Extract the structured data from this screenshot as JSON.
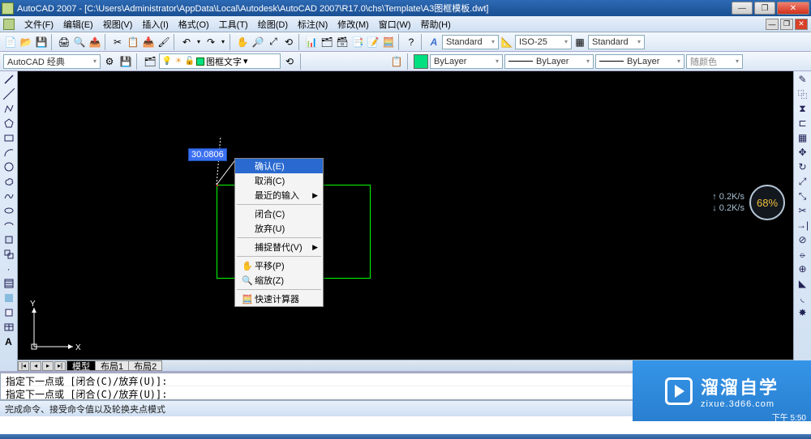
{
  "title": "AutoCAD 2007 - [C:\\Users\\Administrator\\AppData\\Local\\Autodesk\\AutoCAD 2007\\R17.0\\chs\\Template\\A3图框模板.dwt]",
  "menus": [
    "文件(F)",
    "编辑(E)",
    "视图(V)",
    "插入(I)",
    "格式(O)",
    "工具(T)",
    "绘图(D)",
    "标注(N)",
    "修改(M)",
    "窗口(W)",
    "帮助(H)"
  ],
  "workspace_combo": "AutoCAD 经典",
  "layer_combo": "图框文字",
  "style_standard1": "Standard",
  "style_iso": "ISO-25",
  "style_standard2": "Standard",
  "prop_layer": "ByLayer",
  "prop_ltype": "ByLayer",
  "prop_lweight": "ByLayer",
  "prop_color": "随颜色",
  "dim_value": "30.0806",
  "ctx": {
    "confirm": "确认(E)",
    "cancel": "取消(C)",
    "recent": "最近的输入",
    "close": "闭合(C)",
    "undo": "放弃(U)",
    "osnap": "捕捉替代(V)",
    "pan": "平移(P)",
    "zoom": "缩放(Z)",
    "calc": "快速计算器"
  },
  "net": {
    "up": "↑ 0.2K/s",
    "down": "↓ 0.2K/s",
    "pct": "68%"
  },
  "tabs": {
    "model": "模型",
    "layout1": "布局1",
    "layout2": "布局2"
  },
  "cmd1": "指定下一点或 [闭合(C)/放弃(U)]:",
  "cmd2": "指定下一点或 [闭合(C)/放弃(U)]:",
  "status": "完成命令、接受命令值以及轮换夹点模式",
  "watermark": {
    "cn": "溜溜自学",
    "url": "zixue.3d66.com"
  },
  "ucs": {
    "x": "X",
    "y": "Y"
  },
  "clock": "下午 5:50"
}
